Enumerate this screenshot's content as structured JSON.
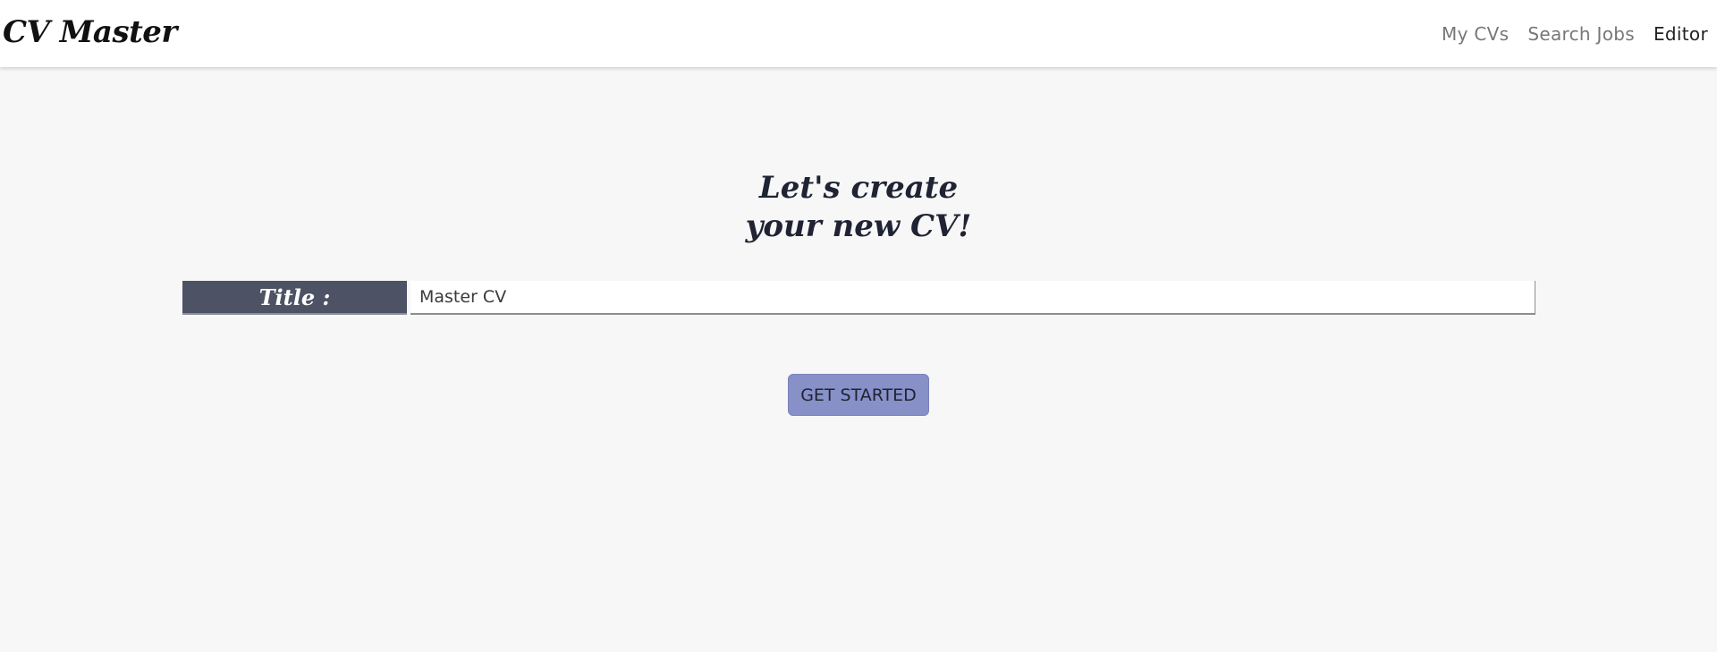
{
  "navbar": {
    "brand": "CV Master",
    "links": [
      {
        "label": "My CVs",
        "active": false
      },
      {
        "label": "Search Jobs",
        "active": false
      },
      {
        "label": "Editor",
        "active": true
      }
    ]
  },
  "hero": {
    "line1": "Let's create",
    "line2": "your new CV!"
  },
  "form": {
    "title_label": "Title :",
    "title_value": "Master CV"
  },
  "actions": {
    "start_label": "GET STARTED"
  },
  "colors": {
    "background": "#f7f7f7",
    "label_bg": "#4d5264",
    "button_bg": "#8890c8"
  }
}
